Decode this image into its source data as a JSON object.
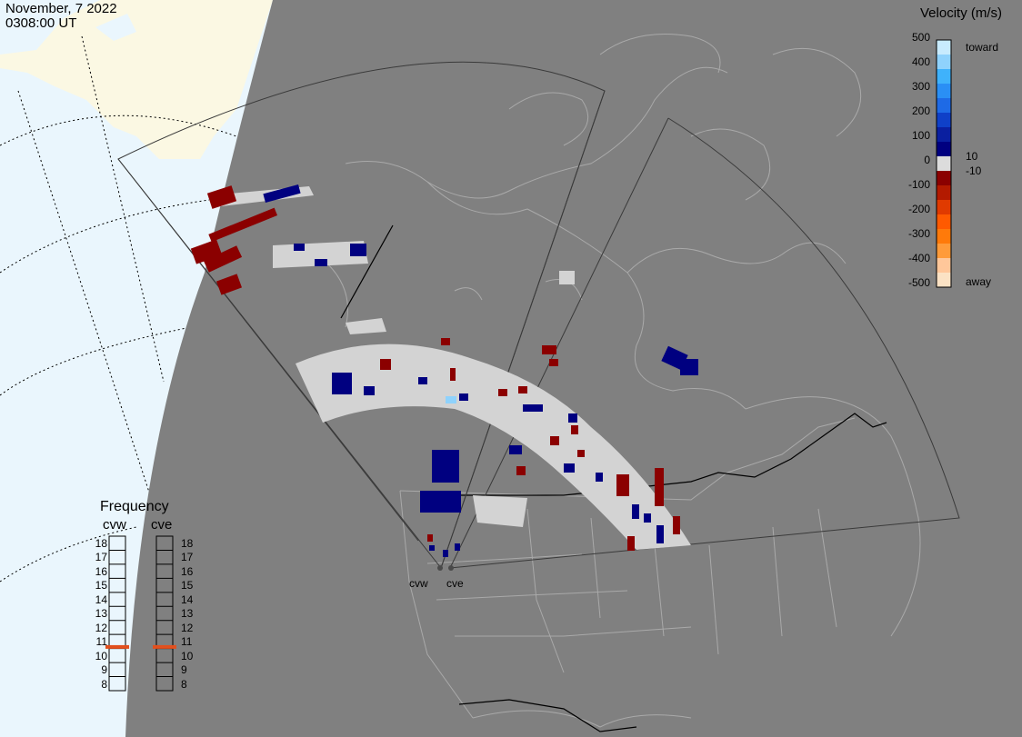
{
  "title": {
    "date": "November, 7 2022",
    "time": "0308:00 UT"
  },
  "legend": {
    "title": "Velocity (m/s)",
    "ticks": [
      "500",
      "400",
      "300",
      "200",
      "100",
      "0",
      "-100",
      "-200",
      "-300",
      "-400",
      "-500"
    ],
    "side_labels": {
      "top": "toward",
      "bottom": "away",
      "plus": "10",
      "minus": "-10"
    },
    "colors": [
      "#fbe2c4",
      "#ffc79a",
      "#ff9b3a",
      "#ff7a0a",
      "#ff5a00",
      "#e03a00",
      "#b31a00",
      "#8b0000",
      "#dcdcdc",
      "#000080",
      "#0a1fa0",
      "#0f40c8",
      "#1e6ae6",
      "#2a8ff5",
      "#3fb2fb",
      "#8fd2fc",
      "#c8ebfe"
    ]
  },
  "frequency": {
    "title": "Frequency",
    "radars": [
      "cvw",
      "cve"
    ],
    "levels": [
      "18",
      "17",
      "16",
      "15",
      "14",
      "13",
      "12",
      "11",
      "10",
      "9",
      "8"
    ],
    "active": {
      "cvw": 11,
      "cve": 11
    },
    "marker_color": "#e2501e"
  },
  "radar_sites": [
    "cvw",
    "cve"
  ],
  "colors": {
    "ocean": "#eaf6fd",
    "land": "#fbf8e3",
    "night": "#808080",
    "boundary": "#a9a9a9",
    "fov": "#3a3a3a",
    "ground_scatter": "#d3d3d3"
  }
}
